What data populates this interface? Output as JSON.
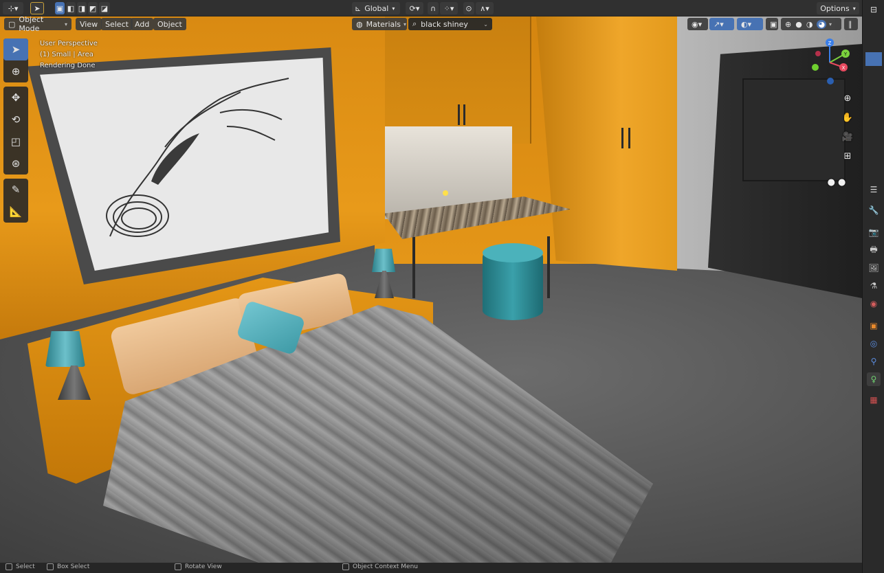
{
  "header": {
    "editor_type_icon": "axis-editor-icon",
    "select_mode_icon": "cursor-select-icon",
    "transform_orientation": "Global",
    "options_label": "Options"
  },
  "viewport_header": {
    "mode": "Object Mode",
    "menus": [
      "View",
      "Select",
      "Add",
      "Object"
    ],
    "material_slot": "Materials",
    "material_name": "black shiney"
  },
  "overlay": {
    "line1": "User Perspective",
    "line2": "(1) Small | Area",
    "line3": "Rendering Done"
  },
  "toolbar": {
    "tools": [
      "select-box-icon",
      "cursor-icon",
      "move-icon",
      "rotate-icon",
      "scale-icon",
      "transform-icon",
      "annotate-icon",
      "measure-icon"
    ]
  },
  "gizmo": {
    "x": "X",
    "y": "Y",
    "z": "Z",
    "colors": {
      "x": "#e84a5f",
      "y": "#7bd13d",
      "z": "#3a7ee8"
    }
  },
  "status_bar": {
    "select": "Select",
    "box_select": "Box Select",
    "rotate_view": "Rotate View",
    "context_menu": "Object Context Menu"
  },
  "colors": {
    "accent": "#4772b3",
    "wall": "#e49618",
    "teal": "#3aa0aa"
  }
}
